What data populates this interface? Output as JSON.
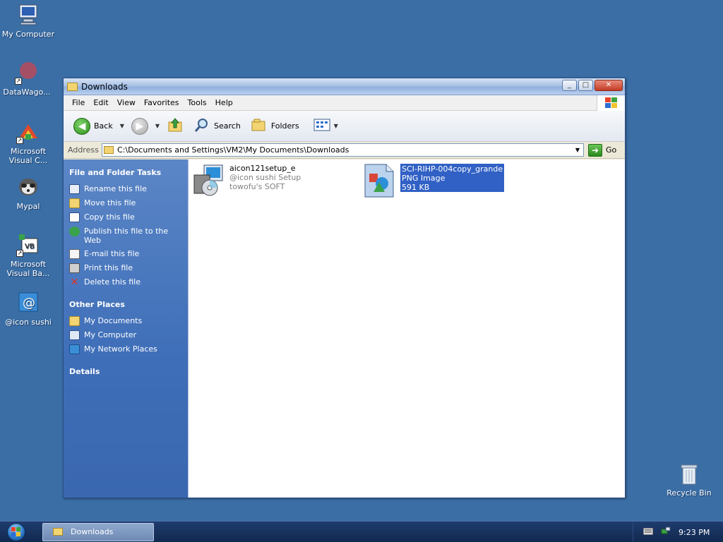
{
  "desktop": {
    "icons": [
      {
        "label": "My Computer",
        "icon": "computer-icon"
      },
      {
        "label": "DataWago...",
        "icon": "datawagon-icon"
      },
      {
        "label": "Microsoft Visual C...",
        "icon": "visual-c-icon"
      },
      {
        "label": "Mypal",
        "icon": "mypal-icon"
      },
      {
        "label": "Microsoft Visual Ba...",
        "icon": "visual-basic-icon"
      },
      {
        "label": "@icon sushi",
        "icon": "icon-sushi-icon"
      }
    ],
    "recycle_bin": "Recycle Bin"
  },
  "window": {
    "title": "Downloads",
    "menu": [
      "File",
      "Edit",
      "View",
      "Favorites",
      "Tools",
      "Help"
    ],
    "toolbar": {
      "back": "Back",
      "search": "Search",
      "folders": "Folders"
    },
    "address": {
      "label": "Address",
      "value": "C:\\Documents and Settings\\VM2\\My Documents\\Downloads",
      "go": "Go"
    },
    "task_pane": {
      "file_tasks_title": "File and Folder Tasks",
      "file_tasks": [
        {
          "label": "Rename this file",
          "icon": "rename-icon"
        },
        {
          "label": "Move this file",
          "icon": "move-icon"
        },
        {
          "label": "Copy this file",
          "icon": "copy-icon"
        },
        {
          "label": "Publish this file to the Web",
          "icon": "publish-icon"
        },
        {
          "label": "E-mail this file",
          "icon": "email-icon"
        },
        {
          "label": "Print this file",
          "icon": "print-icon"
        },
        {
          "label": "Delete this file",
          "icon": "delete-icon"
        }
      ],
      "other_places_title": "Other Places",
      "other_places": [
        {
          "label": "My Documents",
          "icon": "my-documents-icon"
        },
        {
          "label": "My Computer",
          "icon": "my-computer-icon"
        },
        {
          "label": "My Network Places",
          "icon": "network-places-icon"
        }
      ],
      "details_title": "Details"
    },
    "files": [
      {
        "name": "aicon121setup_e",
        "line2": "@icon sushi Setup",
        "line3": "towofu's SOFT",
        "icon": "installer-icon",
        "selected": false
      },
      {
        "name": "SCI-RIHP-004copy_grande",
        "line2": "PNG Image",
        "line3": "591 KB",
        "icon": "png-image-icon",
        "selected": true
      }
    ]
  },
  "taskbar": {
    "task_label": "Downloads",
    "clock": "9:23 PM"
  },
  "colors": {
    "desktop": "#3a6ea5",
    "selection": "#3161c5",
    "taskpane": "#4a78bd"
  }
}
